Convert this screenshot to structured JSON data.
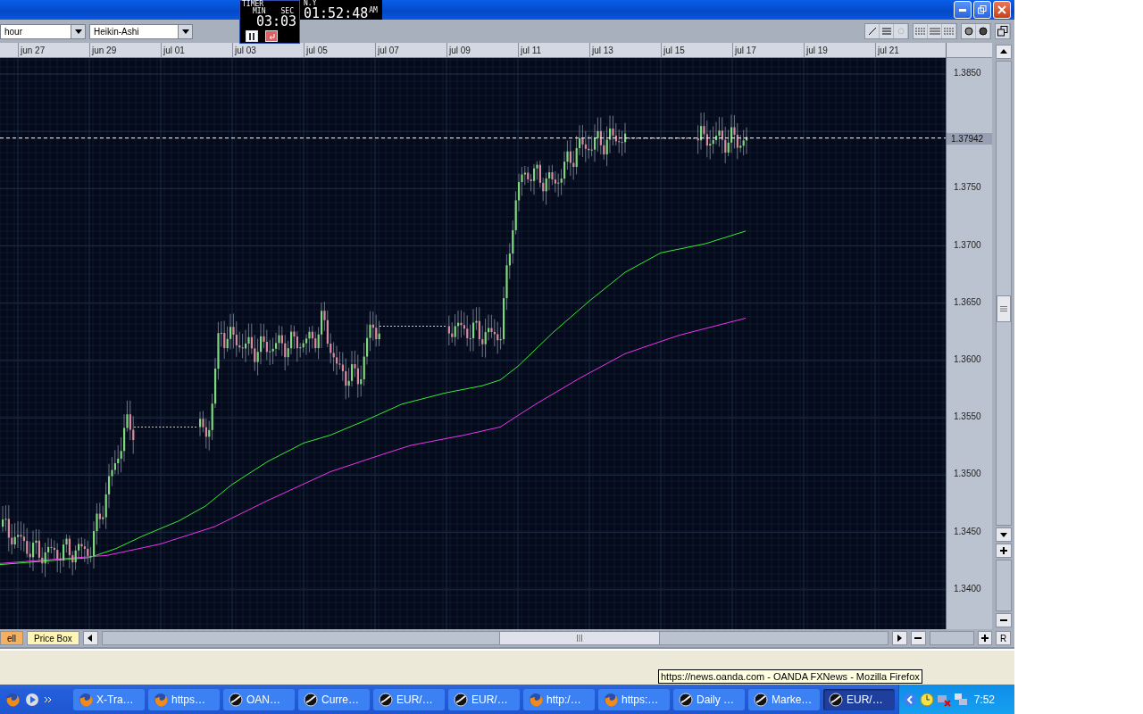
{
  "toolbar": {
    "timeframe": "hour",
    "chart_type": "Heikin-Ashi"
  },
  "timer": {
    "title": "TIMER",
    "min_label": "MIN",
    "sec_label": "SEC",
    "value": "03:03"
  },
  "clock": {
    "label": "N.Y",
    "time": "01:52:48",
    "meridiem": "AM"
  },
  "date_axis": [
    "jun 27",
    "jun 29",
    "jul 01",
    "jul 03",
    "jul 05",
    "jul 07",
    "jul 09",
    "jul 11",
    "jul 13",
    "jul 15",
    "jul 17",
    "jul 19",
    "jul 21"
  ],
  "price_axis": [
    "1.3850",
    "1.3750",
    "1.3700",
    "1.3650",
    "1.3600",
    "1.3550",
    "1.3500",
    "1.3450",
    "1.3400"
  ],
  "current_price": "1.37942",
  "bottom_bar": {
    "buttons": [
      {
        "label": "ell",
        "color": "#f5b062"
      },
      {
        "label": "Price Box",
        "color": "#fff4b8"
      }
    ],
    "reset": "R"
  },
  "taskbar": {
    "items": [
      {
        "label": "X-Tra…",
        "kind": "firefox",
        "selected": false
      },
      {
        "label": "https…",
        "kind": "firefox",
        "selected": false
      },
      {
        "label": "OAN…",
        "kind": "globe",
        "selected": false
      },
      {
        "label": "Curre…",
        "kind": "globe",
        "selected": false
      },
      {
        "label": "EUR/…",
        "kind": "globe",
        "selected": false
      },
      {
        "label": "EUR/…",
        "kind": "globe",
        "selected": false
      },
      {
        "label": "http:/…",
        "kind": "firefox",
        "selected": false
      },
      {
        "label": "https:…",
        "kind": "firefox",
        "selected": false
      },
      {
        "label": "Daily …",
        "kind": "globe",
        "selected": false
      },
      {
        "label": "Marke…",
        "kind": "globe",
        "selected": false
      },
      {
        "label": "EUR/…",
        "kind": "globe",
        "selected": true
      }
    ],
    "time": "7:52"
  },
  "tooltip": "https://news.oanda.com - OANDA FXNews - Mozilla Firefox"
}
